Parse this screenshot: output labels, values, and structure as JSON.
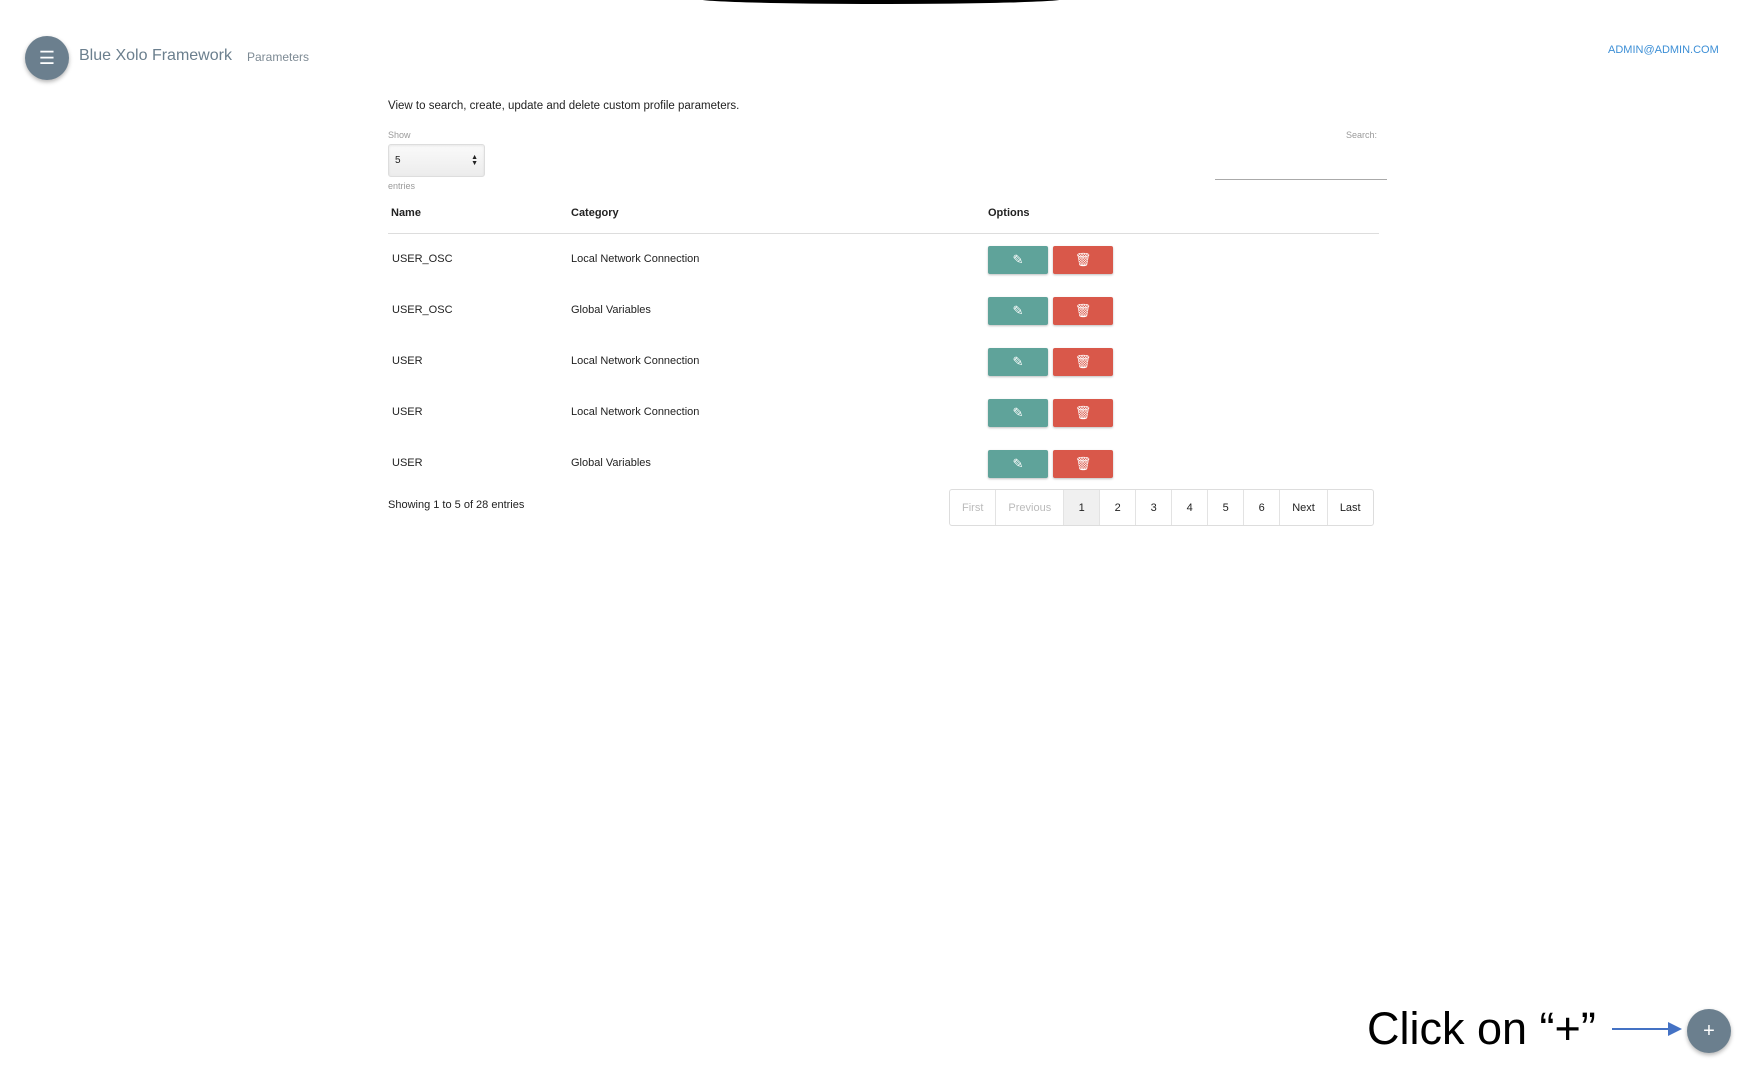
{
  "header": {
    "app_title": "Blue Xolo Framework",
    "breadcrumb": "Parameters",
    "user": "ADMIN@ADMIN.COM",
    "menu_icon": "hamburger-icon"
  },
  "main": {
    "description": "View to search, create, update and delete custom profile parameters.",
    "show_label": "Show",
    "page_size": "5",
    "entries_label": "entries",
    "search_label": "Search:",
    "search_value": "",
    "columns": [
      "Name",
      "Category",
      "Options"
    ],
    "rows": [
      {
        "name": "USER_OSC",
        "category": "Local Network Connection"
      },
      {
        "name": "USER_OSC",
        "category": "Global Variables"
      },
      {
        "name": "USER",
        "category": "Local Network Connection"
      },
      {
        "name": "USER",
        "category": "Local Network Connection"
      },
      {
        "name": "USER",
        "category": "Global Variables"
      }
    ],
    "showing": "Showing 1 to 5 of 28 entries",
    "pagination": [
      "First",
      "Previous",
      "1",
      "2",
      "3",
      "4",
      "5",
      "6",
      "Next",
      "Last"
    ],
    "current_page": "1"
  },
  "colors": {
    "edit": "#5fa39a",
    "delete": "#d9584a",
    "fab": "#6b7f8e",
    "arrow": "#4472c4"
  },
  "annotation": {
    "text": "Click on “+”"
  },
  "fab": {
    "label": "+"
  }
}
